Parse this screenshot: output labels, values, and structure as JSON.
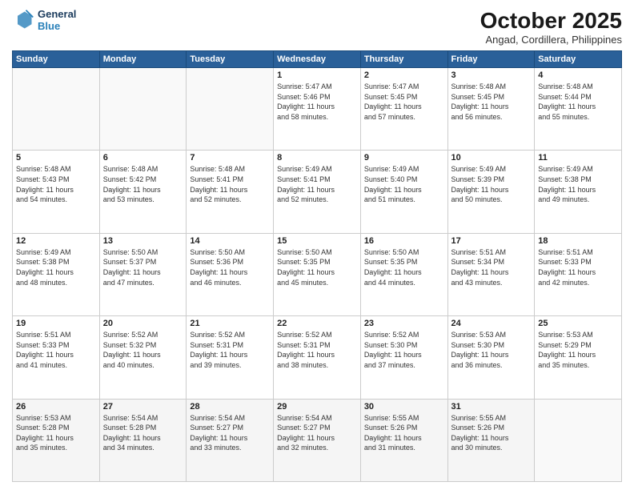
{
  "header": {
    "logo_line1": "General",
    "logo_line2": "Blue",
    "title": "October 2025",
    "subtitle": "Angad, Cordillera, Philippines"
  },
  "weekdays": [
    "Sunday",
    "Monday",
    "Tuesday",
    "Wednesday",
    "Thursday",
    "Friday",
    "Saturday"
  ],
  "weeks": [
    [
      {
        "day": "",
        "info": ""
      },
      {
        "day": "",
        "info": ""
      },
      {
        "day": "",
        "info": ""
      },
      {
        "day": "1",
        "info": "Sunrise: 5:47 AM\nSunset: 5:46 PM\nDaylight: 11 hours\nand 58 minutes."
      },
      {
        "day": "2",
        "info": "Sunrise: 5:47 AM\nSunset: 5:45 PM\nDaylight: 11 hours\nand 57 minutes."
      },
      {
        "day": "3",
        "info": "Sunrise: 5:48 AM\nSunset: 5:45 PM\nDaylight: 11 hours\nand 56 minutes."
      },
      {
        "day": "4",
        "info": "Sunrise: 5:48 AM\nSunset: 5:44 PM\nDaylight: 11 hours\nand 55 minutes."
      }
    ],
    [
      {
        "day": "5",
        "info": "Sunrise: 5:48 AM\nSunset: 5:43 PM\nDaylight: 11 hours\nand 54 minutes."
      },
      {
        "day": "6",
        "info": "Sunrise: 5:48 AM\nSunset: 5:42 PM\nDaylight: 11 hours\nand 53 minutes."
      },
      {
        "day": "7",
        "info": "Sunrise: 5:48 AM\nSunset: 5:41 PM\nDaylight: 11 hours\nand 52 minutes."
      },
      {
        "day": "8",
        "info": "Sunrise: 5:49 AM\nSunset: 5:41 PM\nDaylight: 11 hours\nand 52 minutes."
      },
      {
        "day": "9",
        "info": "Sunrise: 5:49 AM\nSunset: 5:40 PM\nDaylight: 11 hours\nand 51 minutes."
      },
      {
        "day": "10",
        "info": "Sunrise: 5:49 AM\nSunset: 5:39 PM\nDaylight: 11 hours\nand 50 minutes."
      },
      {
        "day": "11",
        "info": "Sunrise: 5:49 AM\nSunset: 5:38 PM\nDaylight: 11 hours\nand 49 minutes."
      }
    ],
    [
      {
        "day": "12",
        "info": "Sunrise: 5:49 AM\nSunset: 5:38 PM\nDaylight: 11 hours\nand 48 minutes."
      },
      {
        "day": "13",
        "info": "Sunrise: 5:50 AM\nSunset: 5:37 PM\nDaylight: 11 hours\nand 47 minutes."
      },
      {
        "day": "14",
        "info": "Sunrise: 5:50 AM\nSunset: 5:36 PM\nDaylight: 11 hours\nand 46 minutes."
      },
      {
        "day": "15",
        "info": "Sunrise: 5:50 AM\nSunset: 5:35 PM\nDaylight: 11 hours\nand 45 minutes."
      },
      {
        "day": "16",
        "info": "Sunrise: 5:50 AM\nSunset: 5:35 PM\nDaylight: 11 hours\nand 44 minutes."
      },
      {
        "day": "17",
        "info": "Sunrise: 5:51 AM\nSunset: 5:34 PM\nDaylight: 11 hours\nand 43 minutes."
      },
      {
        "day": "18",
        "info": "Sunrise: 5:51 AM\nSunset: 5:33 PM\nDaylight: 11 hours\nand 42 minutes."
      }
    ],
    [
      {
        "day": "19",
        "info": "Sunrise: 5:51 AM\nSunset: 5:33 PM\nDaylight: 11 hours\nand 41 minutes."
      },
      {
        "day": "20",
        "info": "Sunrise: 5:52 AM\nSunset: 5:32 PM\nDaylight: 11 hours\nand 40 minutes."
      },
      {
        "day": "21",
        "info": "Sunrise: 5:52 AM\nSunset: 5:31 PM\nDaylight: 11 hours\nand 39 minutes."
      },
      {
        "day": "22",
        "info": "Sunrise: 5:52 AM\nSunset: 5:31 PM\nDaylight: 11 hours\nand 38 minutes."
      },
      {
        "day": "23",
        "info": "Sunrise: 5:52 AM\nSunset: 5:30 PM\nDaylight: 11 hours\nand 37 minutes."
      },
      {
        "day": "24",
        "info": "Sunrise: 5:53 AM\nSunset: 5:30 PM\nDaylight: 11 hours\nand 36 minutes."
      },
      {
        "day": "25",
        "info": "Sunrise: 5:53 AM\nSunset: 5:29 PM\nDaylight: 11 hours\nand 35 minutes."
      }
    ],
    [
      {
        "day": "26",
        "info": "Sunrise: 5:53 AM\nSunset: 5:28 PM\nDaylight: 11 hours\nand 35 minutes."
      },
      {
        "day": "27",
        "info": "Sunrise: 5:54 AM\nSunset: 5:28 PM\nDaylight: 11 hours\nand 34 minutes."
      },
      {
        "day": "28",
        "info": "Sunrise: 5:54 AM\nSunset: 5:27 PM\nDaylight: 11 hours\nand 33 minutes."
      },
      {
        "day": "29",
        "info": "Sunrise: 5:54 AM\nSunset: 5:27 PM\nDaylight: 11 hours\nand 32 minutes."
      },
      {
        "day": "30",
        "info": "Sunrise: 5:55 AM\nSunset: 5:26 PM\nDaylight: 11 hours\nand 31 minutes."
      },
      {
        "day": "31",
        "info": "Sunrise: 5:55 AM\nSunset: 5:26 PM\nDaylight: 11 hours\nand 30 minutes."
      },
      {
        "day": "",
        "info": ""
      }
    ]
  ]
}
